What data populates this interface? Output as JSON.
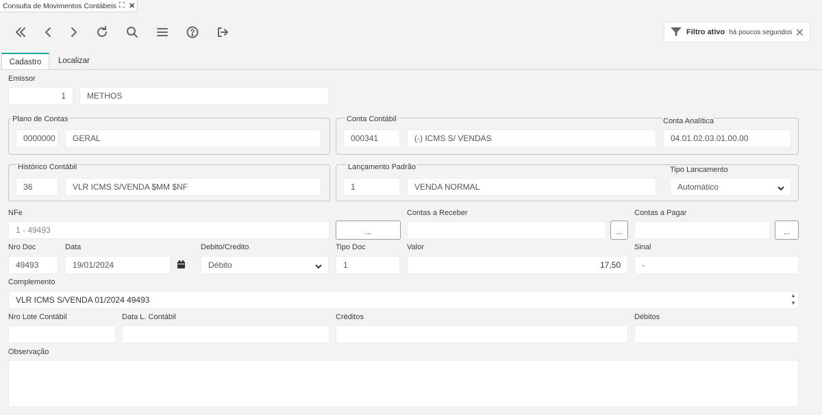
{
  "window_tab": {
    "title": "Consulta de Movimentos Contábeis"
  },
  "toolbar": {
    "buttons": [
      "first-icon",
      "previous-icon",
      "next-icon",
      "refresh-icon",
      "search-icon",
      "menu-icon",
      "help-icon",
      "exit-icon"
    ]
  },
  "filter": {
    "label": "Filtro ativo",
    "time": "há poucos segundos"
  },
  "tabs": [
    "Cadastro",
    "Localizar"
  ],
  "emissor": {
    "label": "Emissor",
    "code": "1",
    "name": "METHOS"
  },
  "plano_contas": {
    "label": "Plano de Contas",
    "code": "0000000",
    "name": "GERAL"
  },
  "conta_contabil": {
    "label": "Conta Contábil",
    "code": "000341",
    "name": "(-) ICMS S/ VENDAS"
  },
  "conta_analitica": {
    "label": "Conta Analítica",
    "value": "04.01.02.03.01.00.00"
  },
  "historico": {
    "label": "Histórico Contábil",
    "code": "36",
    "text": "VLR ICMS S/VENDA $MM $NF"
  },
  "lancamento_padrao": {
    "label": "Lançamento Padrão",
    "code": "1",
    "text": "VENDA NORMAL"
  },
  "tipo_lancamento": {
    "label": "Tipo Lancamento",
    "value": "Automático"
  },
  "nfe": {
    "label": "NFe",
    "value": "1 - 49493",
    "button": "..."
  },
  "contas_receber": {
    "label": "Contas a Receber",
    "value": "",
    "button": "..."
  },
  "contas_pagar": {
    "label": "Contas a Pagar",
    "value": "",
    "button": "..."
  },
  "nro_doc": {
    "label": "Nro Doc",
    "value": "49493"
  },
  "data": {
    "label": "Data",
    "value": "19/01/2024"
  },
  "debito_credito": {
    "label": "Debito/Credito",
    "value": "Débito"
  },
  "tipo_doc": {
    "label": "Tipo Doc",
    "value": "1"
  },
  "valor": {
    "label": "Valor",
    "value": "17,50"
  },
  "sinal": {
    "label": "Sinal",
    "value": "-"
  },
  "complemento": {
    "label": "Complemento",
    "value": "VLR ICMS S/VENDA 01/2024 49493"
  },
  "nro_lote": {
    "label": "Nro Lote Contábil",
    "value": ""
  },
  "data_lote": {
    "label": "Data L. Contábil",
    "value": ""
  },
  "creditos": {
    "label": "Créditos",
    "value": ""
  },
  "debitos": {
    "label": "Débitos",
    "value": ""
  },
  "observacao": {
    "label": "Observação",
    "value": ""
  }
}
